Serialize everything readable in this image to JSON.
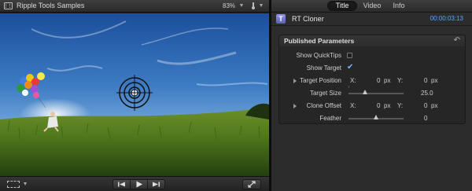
{
  "viewer": {
    "title": "Ripple Tools Samples",
    "zoom": "83%",
    "icons": {
      "film": "film-icon",
      "zoom_menu": "chevron-down-icon",
      "view_options": "thermometer-icon",
      "view_menu": "chevron-down-icon"
    }
  },
  "transport": {
    "icons": {
      "crop": "crop-icon",
      "crop_menu": "chevron-down-icon",
      "previous": "skip-back-icon",
      "play": "play-icon",
      "next": "skip-forward-icon",
      "fullscreen": "fullscreen-icon"
    }
  },
  "inspector": {
    "tabs": [
      {
        "label": "Title",
        "active": true
      },
      {
        "label": "Video",
        "active": false
      },
      {
        "label": "Info",
        "active": false
      }
    ],
    "clip": {
      "icon_letter": "T",
      "name": "RT Cloner",
      "timecode": "00:00:03:13",
      "timecode_color": "#58a8ff"
    },
    "params": {
      "header": "Published Parameters",
      "reset_icon": "reset-arrow-icon",
      "show_quicktips": {
        "label": "Show QuickTips",
        "checked": false
      },
      "show_target": {
        "label": "Show Target",
        "checked": true
      },
      "target_position": {
        "label": "Target Position",
        "x_label": "X:",
        "x_value": "0",
        "x_unit": "px",
        "y_label": "Y:",
        "y_value": "0",
        "y_unit": "px"
      },
      "target_size": {
        "label": "Target Size",
        "value": "25.0",
        "level": 0.3
      },
      "clone_offset": {
        "label": "Clone Offset",
        "x_label": "X:",
        "x_value": "0",
        "x_unit": "px",
        "y_label": "Y:",
        "y_value": "0",
        "y_unit": "px"
      },
      "feather": {
        "label": "Feather",
        "value": "0",
        "level": 0.5
      }
    }
  }
}
